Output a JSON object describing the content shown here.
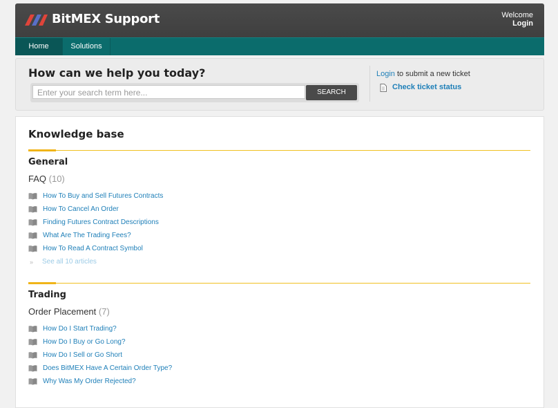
{
  "header": {
    "brand": "BitMEX Support",
    "welcome": "Welcome",
    "login": "Login"
  },
  "nav": {
    "items": [
      "Home",
      "Solutions"
    ]
  },
  "search": {
    "title": "How can we help you today?",
    "placeholder": "Enter your search term here...",
    "button": "SEARCH"
  },
  "ticket": {
    "login_link": "Login",
    "login_rest": " to submit a new ticket",
    "check_status": "Check ticket status"
  },
  "kb": {
    "title": "Knowledge base",
    "sections": [
      {
        "title": "General",
        "folder": "FAQ",
        "count": "(10)",
        "articles": [
          "How To Buy and Sell Futures Contracts",
          "How To Cancel An Order",
          "Finding Futures Contract Descriptions",
          "What Are The Trading Fees?",
          "How To Read A Contract Symbol"
        ],
        "see_all": "See all 10 articles"
      },
      {
        "title": "Trading",
        "folder": "Order Placement",
        "count": "(7)",
        "articles": [
          "How Do I Start Trading?",
          "How Do I Buy or Go Long?",
          "How Do I Sell or Go Short",
          "Does BitMEX Have A Certain Order Type?",
          "Why Was My Order Rejected?"
        ]
      }
    ]
  },
  "colors": {
    "header": "#464646",
    "nav": "#0b6c6c",
    "accent": "#f0b418",
    "link": "#1e7fb8"
  }
}
